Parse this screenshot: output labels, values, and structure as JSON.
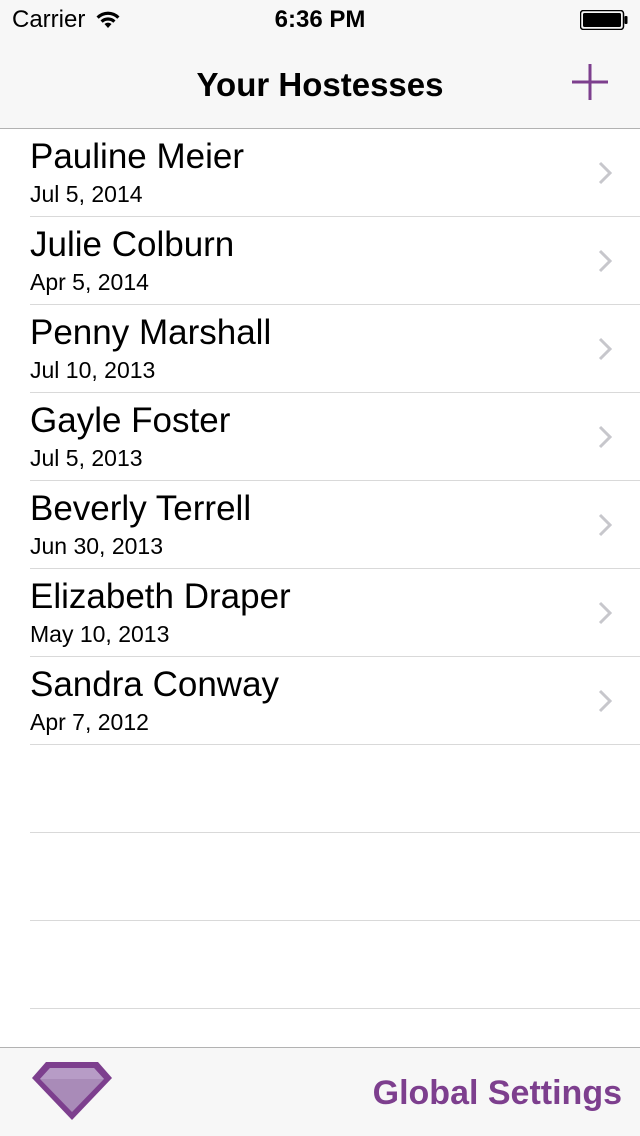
{
  "status_bar": {
    "carrier": "Carrier",
    "time": "6:36 PM"
  },
  "nav": {
    "title": "Your Hostesses",
    "add_icon": "plus-icon"
  },
  "hostesses": [
    {
      "name": "Pauline Meier",
      "date": "Jul 5, 2014"
    },
    {
      "name": "Julie Colburn",
      "date": "Apr 5, 2014"
    },
    {
      "name": "Penny Marshall",
      "date": "Jul 10, 2013"
    },
    {
      "name": "Gayle Foster",
      "date": "Jul 5, 2013"
    },
    {
      "name": "Beverly Terrell",
      "date": "Jun 30, 2013"
    },
    {
      "name": "Elizabeth Draper",
      "date": "May 10, 2013"
    },
    {
      "name": "Sandra Conway",
      "date": "Apr 7, 2012"
    }
  ],
  "toolbar": {
    "gem_icon": "gem-icon",
    "settings_label": "Global Settings"
  },
  "colors": {
    "accent": "#7d3f8e",
    "bar_background": "#f7f7f7",
    "separator": "#d9d9d9",
    "chevron": "#c7c7cc"
  }
}
